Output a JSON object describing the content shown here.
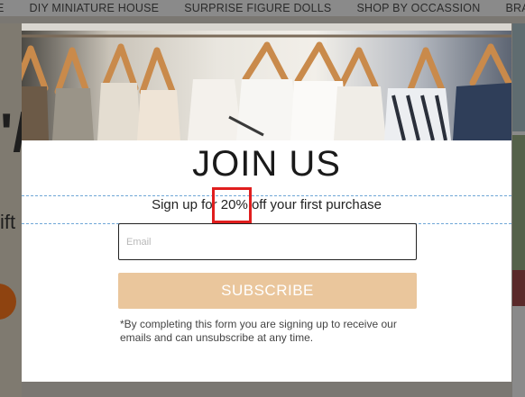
{
  "background": {
    "nav": [
      "E",
      "DIY MINIATURE HOUSE",
      "SURPRISE FIGURE DOLLS",
      "SHOP BY OCCASSION",
      "BRAN"
    ],
    "left_big": "'/",
    "left_text": "ift"
  },
  "modal": {
    "title": "JOIN US",
    "subtitle": "Sign up for 20% off your first purchase",
    "email_placeholder": "Email",
    "subscribe_label": "SUBSCRIBE",
    "disclaimer": "*By completing this form you are signing up to receive our emails and can unsubscribe at any time."
  },
  "colors": {
    "subscribe_bg": "#eac69c",
    "highlight": "#e01e1e",
    "guide": "#6fa7d6"
  }
}
